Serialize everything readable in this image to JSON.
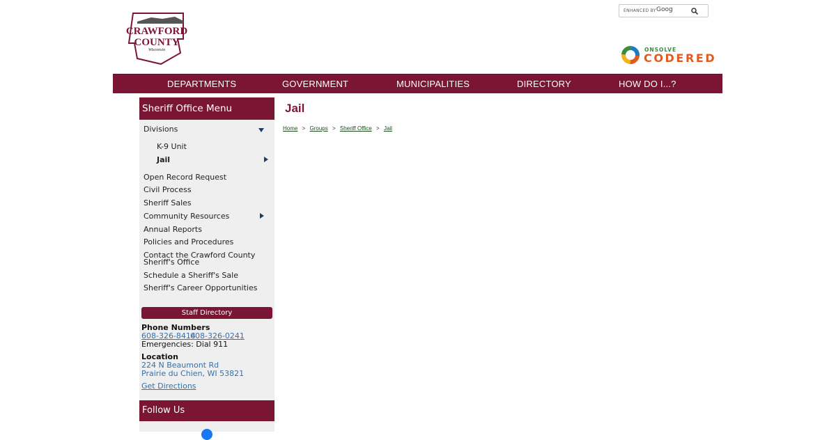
{
  "header": {
    "logo_line1": "CRAWFORD",
    "logo_line2": "COUNTY",
    "logo_line3": "Wisconsin",
    "search_enhanced": "ENHANCED BY",
    "search_brand": "Goog",
    "onsolve": "ONSOLVE",
    "codered": "CODERED"
  },
  "nav": {
    "items": [
      "DEPARTMENTS",
      "GOVERNMENT",
      "MUNICIPALITIES",
      "DIRECTORY",
      "HOW DO I...?"
    ]
  },
  "sidebar": {
    "title": "Sheriff Office Menu",
    "divisions": "Divisions",
    "sub_items": [
      "K-9 Unit",
      "Jail"
    ],
    "items": [
      "Open Record Request",
      "Civil Process",
      "Sheriff Sales",
      "Community Resources",
      "Annual Reports",
      "Policies and Procedures",
      "Contact the Crawford County",
      "Sheriff's Office",
      "Schedule a Sheriff's Sale",
      "Sheriff's Career Opportunities"
    ],
    "staff_directory": "Staff Directory",
    "phone_heading": "Phone Numbers",
    "phone1": "608-326-8414",
    "phone2": "608-326-0241",
    "emergencies": "Emergencies: Dial 911",
    "location_heading": "Location",
    "address1": "224 N Beaumont Rd",
    "address2": "Prairie du Chien, WI 53821",
    "directions": "Get Directions",
    "follow_us": "Follow Us"
  },
  "main": {
    "title": "Jail",
    "breadcrumb": [
      "Home",
      "Groups",
      "Sheriff Office",
      "Jail"
    ],
    "sep": ">"
  },
  "colors": {
    "brand": "#7a1633",
    "link": "#3a6ea5",
    "caret": "#1f3b66"
  }
}
